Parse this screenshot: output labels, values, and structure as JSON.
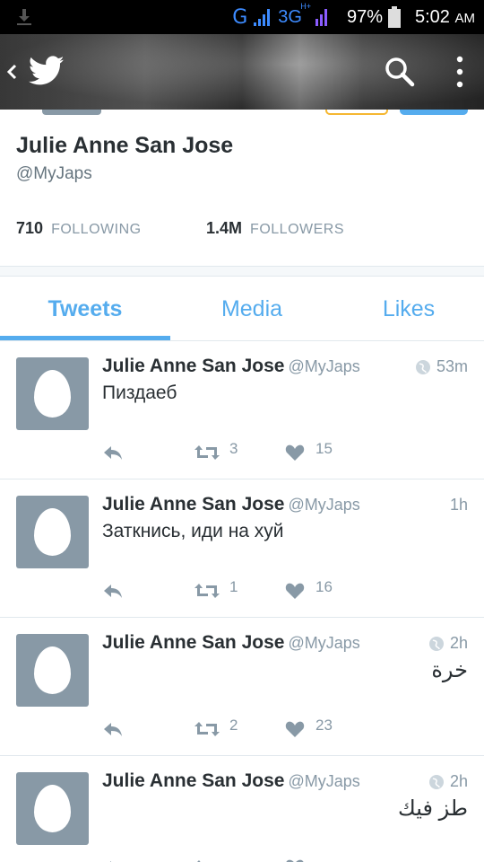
{
  "status_bar": {
    "network_g": "G",
    "network_3g": "3G",
    "network_hplus": "H+",
    "battery": "97%",
    "time": "5:02",
    "ampm": "AM"
  },
  "header": {
    "back_icon": "chevron-left-icon",
    "logo_icon": "twitter-bird-icon",
    "search_icon": "search-icon",
    "more_icon": "more-vertical-icon"
  },
  "profile": {
    "name": "Julie Anne San Jose",
    "handle": "@MyJaps",
    "following_count": "710",
    "following_label": "FOLLOWING",
    "followers_count": "1.4M",
    "followers_label": "FOLLOWERS"
  },
  "tabs": [
    {
      "label": "Tweets",
      "active": true
    },
    {
      "label": "Media",
      "active": false
    },
    {
      "label": "Likes",
      "active": false
    }
  ],
  "colors": {
    "accent": "#55acee",
    "muted": "#8899a6",
    "text": "#292f33"
  },
  "tweets": [
    {
      "name": "Julie Anne San Jose",
      "handle": "@MyJaps",
      "time": "53m",
      "text": "Пиздаеб",
      "retweets": "3",
      "likes": "15",
      "globe": true
    },
    {
      "name": "Julie Anne San Jose",
      "handle": "@MyJaps",
      "time": "1h",
      "text": "Заткнись, иди на хуй",
      "retweets": "1",
      "likes": "16",
      "globe": false
    },
    {
      "name": "Julie Anne San Jose",
      "handle": "@MyJaps",
      "time": "2h",
      "text": "خرة",
      "retweets": "2",
      "likes": "23",
      "globe": true
    },
    {
      "name": "Julie Anne San Jose",
      "handle": "@MyJaps",
      "time": "2h",
      "text": "طز فيك",
      "retweets": "",
      "likes": "",
      "globe": true
    }
  ]
}
